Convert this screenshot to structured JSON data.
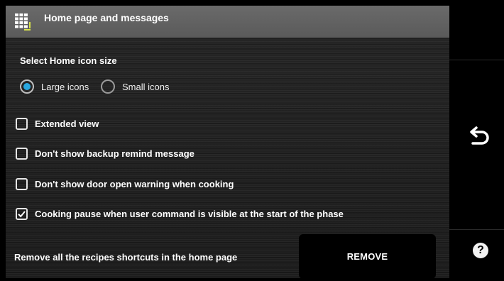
{
  "header": {
    "title": "Home page and messages",
    "icon": "grid-icon"
  },
  "icon_size": {
    "title": "Select Home icon size",
    "options": [
      {
        "label": "Large icons",
        "selected": true
      },
      {
        "label": "Small icons",
        "selected": false
      }
    ]
  },
  "options": [
    {
      "label": "Extended view",
      "checked": false
    },
    {
      "label": "Don't show backup remind message",
      "checked": false
    },
    {
      "label": "Don't show door open warning when cooking",
      "checked": false
    },
    {
      "label": "Cooking pause when user command is visible at the start of the phase",
      "checked": true
    }
  ],
  "shortcuts": {
    "label": "Remove all the recipes shortcuts in the home page",
    "button_label": "REMOVE"
  },
  "sidebar": {
    "back_icon": "back-arrow-icon",
    "help_label": "?"
  },
  "colors": {
    "accent": "#29a8e0",
    "header_bg": "#5e5e5e",
    "background": "#1f1f1f"
  }
}
